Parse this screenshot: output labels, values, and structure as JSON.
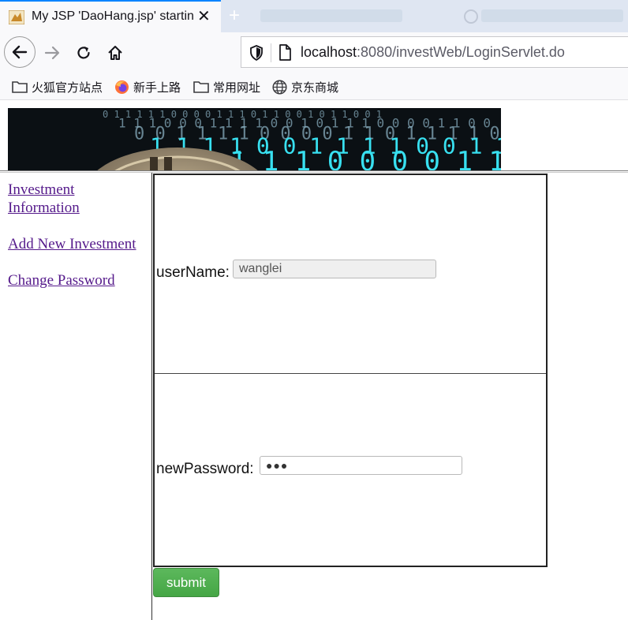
{
  "browser": {
    "active_tab_title": "My JSP 'DaoHang.jsp' starting page",
    "url_host": "localhost",
    "url_rest": ":8080/investWeb/LoginServlet.do",
    "bookmarks": [
      "火狐官方站点",
      "新手上路",
      "常用网址",
      "京东商城"
    ],
    "accent_color": "#0a84ff"
  },
  "sidebar": {
    "links": [
      "Investment Information",
      "Add New Investment",
      "Change Password"
    ],
    "link_color": "#551a8b"
  },
  "form": {
    "username_label": "userName:",
    "username_value": "wanglei",
    "newpassword_label": "newPassword:",
    "newpassword_masked": "●●●",
    "submit_label": "submit",
    "submit_color": "#5cb85c"
  },
  "banner": {
    "binary_rows": [
      "0 1 1 1 1 1 0 0 0 0 1 1 1 0 1 1 0 0 1 0 1 1 0 0 1",
      "1 1 1 0 0 0 1 1 1 1 0 0 1 0 1 1 1 0 0 0 0 1 1 0 0",
      "0 0 1 1 1 1 0 0 0 0 1 1 0 1 1 1 1 0 0 0 1 1 0 0 0",
      "1 1 1 1 0 0 1 1 1 1 0 0 1 1 1 1 0 0 0 0 1 1 0 0 1",
      "0 1 1 1 1 0 0 0 0 1 1 1 0 0 1 1 0 0 1 1 0 0 1 1 0"
    ]
  }
}
